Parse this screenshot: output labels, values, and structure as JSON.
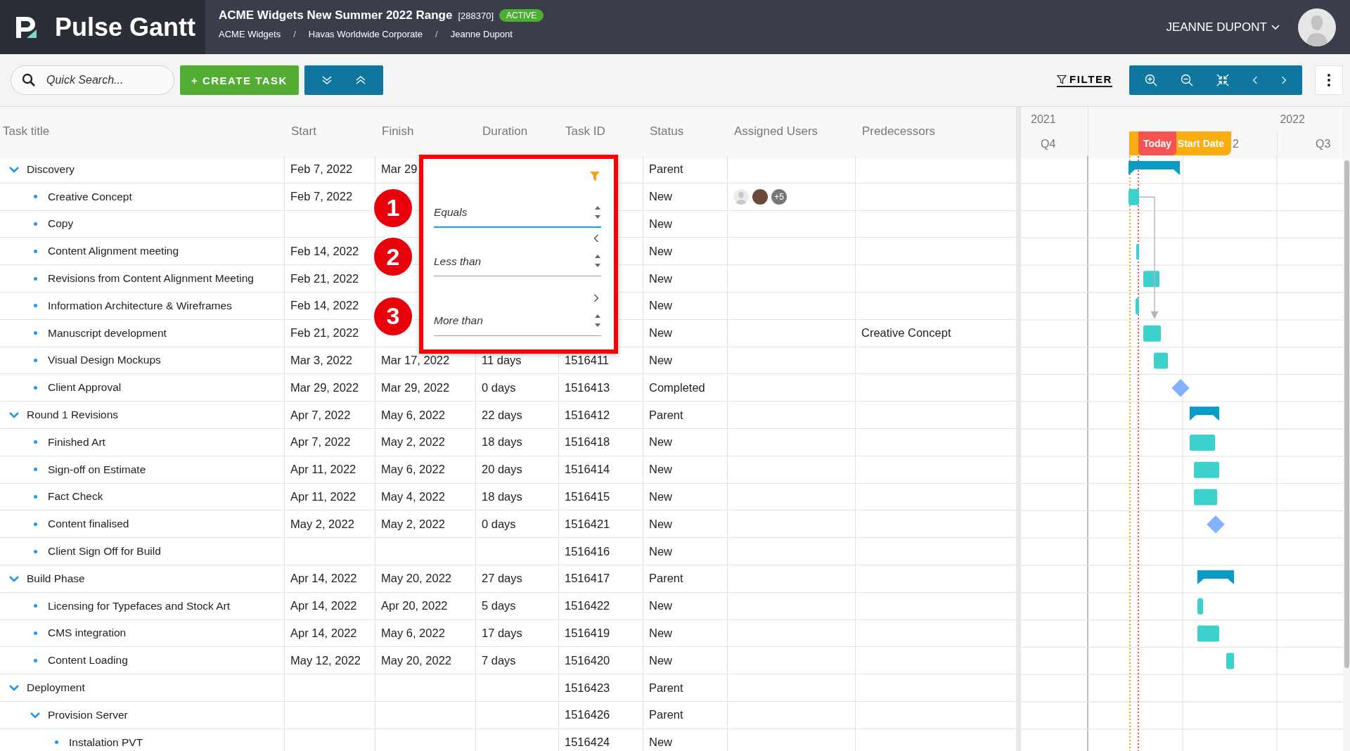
{
  "app": {
    "name": "Pulse Gantt"
  },
  "project": {
    "title": "ACME Widgets New Summer 2022 Range",
    "code": "[288370]",
    "badge": "ACTIVE",
    "breadcrumbs": [
      {
        "kind": "link",
        "label": "ACME Widgets"
      },
      {
        "kind": "separator",
        "label": "/"
      },
      {
        "kind": "link",
        "label": "Havas Worldwide Corporate"
      },
      {
        "kind": "separator",
        "label": "/"
      },
      {
        "kind": "link",
        "label": "Jeanne Dupont"
      }
    ]
  },
  "user": {
    "name": "JEANNE DUPONT"
  },
  "toolbar": {
    "search": {
      "placeholder": "Quick Search..."
    },
    "create_button": "+ CREATE TASK",
    "filter_link": "FILTER"
  },
  "table": {
    "columns": [
      "Task title",
      "Start",
      "Finish",
      "Duration",
      "Task ID",
      "Status",
      "Assigned Users",
      "Predecessors"
    ]
  },
  "tasks": [
    {
      "title": "Discovery",
      "start": "Feb 7, 2022",
      "finish": "Mar 29",
      "status": "Parent",
      "expanded": true,
      "kind": "summary",
      "children": [
        {
          "title": "Creative Concept",
          "start": "Feb 7, 2022",
          "status": "New",
          "kind": "task",
          "assigned_users": [
            {
              "kind": "placeholder"
            },
            {
              "kind": "photo"
            },
            {
              "kind": "more",
              "label": "+5"
            }
          ]
        },
        {
          "title": "Copy",
          "status": "New"
        },
        {
          "title": "Content Alignment meeting",
          "start": "Feb 14, 2022",
          "status": "New",
          "kind": "task"
        },
        {
          "title": "Revisions from Content Alignment Meeting",
          "start": "Feb 21, 2022",
          "status": "New",
          "kind": "task"
        },
        {
          "title": "Information Architecture & Wireframes",
          "start": "Feb 14, 2022",
          "status": "New",
          "kind": "task"
        },
        {
          "title": "Manuscript development",
          "start": "Feb 21, 2022",
          "status": "New",
          "predecessors": "Creative Concept",
          "kind": "task"
        },
        {
          "title": "Visual Design Mockups",
          "start": "Mar 3, 2022",
          "finish": "Mar 17, 2022",
          "duration": "11 days",
          "task_id": "1516411",
          "status": "New",
          "kind": "task"
        },
        {
          "title": "Client Approval",
          "start": "Mar 29, 2022",
          "finish": "Mar 29, 2022",
          "duration": "0 days",
          "task_id": "1516413",
          "status": "Completed",
          "kind": "milestone"
        }
      ]
    },
    {
      "title": "Round 1 Revisions",
      "start": "Apr 7, 2022",
      "finish": "May 6, 2022",
      "duration": "22 days",
      "task_id": "1516412",
      "status": "Parent",
      "expanded": true,
      "kind": "summary",
      "children": [
        {
          "title": "Finished Art",
          "start": "Apr 7, 2022",
          "finish": "May 2, 2022",
          "duration": "18 days",
          "task_id": "1516418",
          "status": "New",
          "kind": "task"
        },
        {
          "title": "Sign-off on Estimate",
          "start": "Apr 11, 2022",
          "finish": "May 6, 2022",
          "duration": "20 days",
          "task_id": "1516414",
          "status": "New",
          "kind": "task"
        },
        {
          "title": "Fact Check",
          "start": "Apr 11, 2022",
          "finish": "May 4, 2022",
          "duration": "18 days",
          "task_id": "1516415",
          "status": "New",
          "kind": "task"
        },
        {
          "title": "Content finalised",
          "start": "May 2, 2022",
          "finish": "May 2, 2022",
          "duration": "0 days",
          "task_id": "1516421",
          "status": "New",
          "kind": "milestone"
        },
        {
          "title": "Client Sign Off for Build",
          "task_id": "1516416",
          "status": "New"
        }
      ]
    },
    {
      "title": "Build Phase",
      "start": "Apr 14, 2022",
      "finish": "May 20, 2022",
      "duration": "27 days",
      "task_id": "1516417",
      "status": "Parent",
      "expanded": true,
      "kind": "summary",
      "children": [
        {
          "title": "Licensing for Typefaces and Stock Art",
          "start": "Apr 14, 2022",
          "finish": "Apr 20, 2022",
          "duration": "5 days",
          "task_id": "1516422",
          "status": "New",
          "kind": "task"
        },
        {
          "title": "CMS integration",
          "start": "Apr 14, 2022",
          "finish": "May 6, 2022",
          "duration": "17 days",
          "task_id": "1516419",
          "status": "New",
          "kind": "task"
        },
        {
          "title": "Content Loading",
          "start": "May 12, 2022",
          "finish": "May 20, 2022",
          "duration": "7 days",
          "task_id": "1516420",
          "status": "New",
          "kind": "task"
        }
      ]
    },
    {
      "title": "Deployment",
      "task_id": "1516423",
      "status": "Parent",
      "expanded": true,
      "children": [
        {
          "title": "Provision Server",
          "task_id": "1516426",
          "status": "Parent",
          "expanded": true,
          "children": [
            {
              "title": "Instalation PVT",
              "task_id": "1516424",
              "status": "New"
            }
          ]
        }
      ]
    }
  ],
  "filter_popup": {
    "fields": [
      {
        "placeholder": "Equals",
        "focused": true,
        "callout": "1"
      },
      {
        "placeholder": "Less than",
        "focused": false,
        "callout": "2"
      },
      {
        "placeholder": "More than",
        "focused": false,
        "callout": "3"
      }
    ]
  },
  "gantt": {
    "years": [
      "2021",
      "2022"
    ],
    "quarter_labels": [
      {
        "label": "Q4"
      },
      {
        "label": "2"
      },
      {
        "label": "Q3"
      }
    ],
    "markers": [
      {
        "kind": "today",
        "label": "Today"
      },
      {
        "kind": "start",
        "label": "Start Date"
      }
    ]
  }
}
